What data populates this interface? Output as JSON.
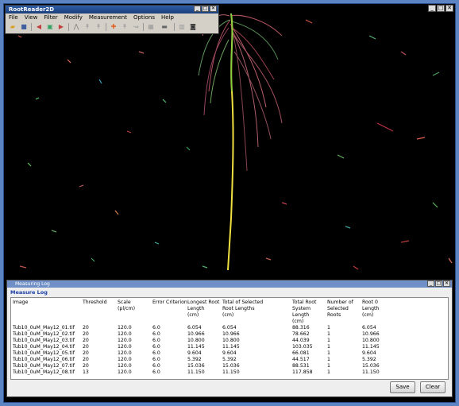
{
  "app_window": {
    "title": "RootReader2D",
    "menus": [
      "File",
      "View",
      "Filter",
      "Modify",
      "Measurement",
      "Options",
      "Help"
    ],
    "toolbar_icons": [
      "open-folder-icon",
      "save-icon",
      "undo-icon",
      "image-icon",
      "redo-icon",
      "root-tool-icon",
      "branch-tool-icon",
      "branch-tool2-icon",
      "add-root-icon",
      "add-branch-icon",
      "edit-branch-icon",
      "scale-icon",
      "ruler-icon",
      "export-icon",
      "camera-icon"
    ]
  },
  "log_window": {
    "title": "Measuring Log",
    "tab": "Measure Log",
    "columns": [
      [
        "Image"
      ],
      [
        "Threshold"
      ],
      [
        "Scale",
        "(pl/cm)"
      ],
      [
        "Error Criterion"
      ],
      [
        "Longest Root",
        "Length",
        "(cm)"
      ],
      [
        "Total of Selected",
        "Root Lengths",
        "(cm)"
      ],
      [
        "Total Root",
        "System Length",
        "(cm)"
      ],
      [
        "Number of",
        "Selected Roots"
      ],
      [
        "Root 0",
        "Length",
        "(cm)"
      ]
    ],
    "rows": [
      [
        "Tub10_0uM_May12_01.tif",
        "20",
        "120.0",
        "6.0",
        "6.054",
        "6.054",
        "88.316",
        "1",
        "6.054"
      ],
      [
        "Tub10_0uM_May12_02.tif",
        "20",
        "120.0",
        "6.0",
        "10.966",
        "10.966",
        "78.662",
        "1",
        "10.966"
      ],
      [
        "Tub10_0uM_May12_03.tif",
        "20",
        "120.0",
        "6.0",
        "10.800",
        "10.800",
        "44.039",
        "1",
        "10.800"
      ],
      [
        "Tub10_0uM_May12_04.tif",
        "20",
        "120.0",
        "6.0",
        "11.145",
        "11.145",
        "103.035",
        "1",
        "11.145"
      ],
      [
        "Tub10_0uM_May12_05.tif",
        "20",
        "120.0",
        "6.0",
        "9.604",
        "9.604",
        "66.081",
        "1",
        "9.604"
      ],
      [
        "Tub10_0uM_May12_06.tif",
        "20",
        "120.0",
        "6.0",
        "5.392",
        "5.392",
        "44.517",
        "1",
        "5.392"
      ],
      [
        "Tub10_0uM_May12_07.tif",
        "20",
        "120.0",
        "6.0",
        "15.036",
        "15.036",
        "88.531",
        "1",
        "15.036"
      ],
      [
        "Tub10_0uM_May12_08.tif",
        "13",
        "120.0",
        "6.0",
        "11.150",
        "11.150",
        "117.858",
        "1",
        "11.150"
      ]
    ],
    "save_label": "Save",
    "clear_label": "Clear"
  },
  "window_controls": {
    "minimize": "_",
    "maximize": "□",
    "close": "✕"
  }
}
